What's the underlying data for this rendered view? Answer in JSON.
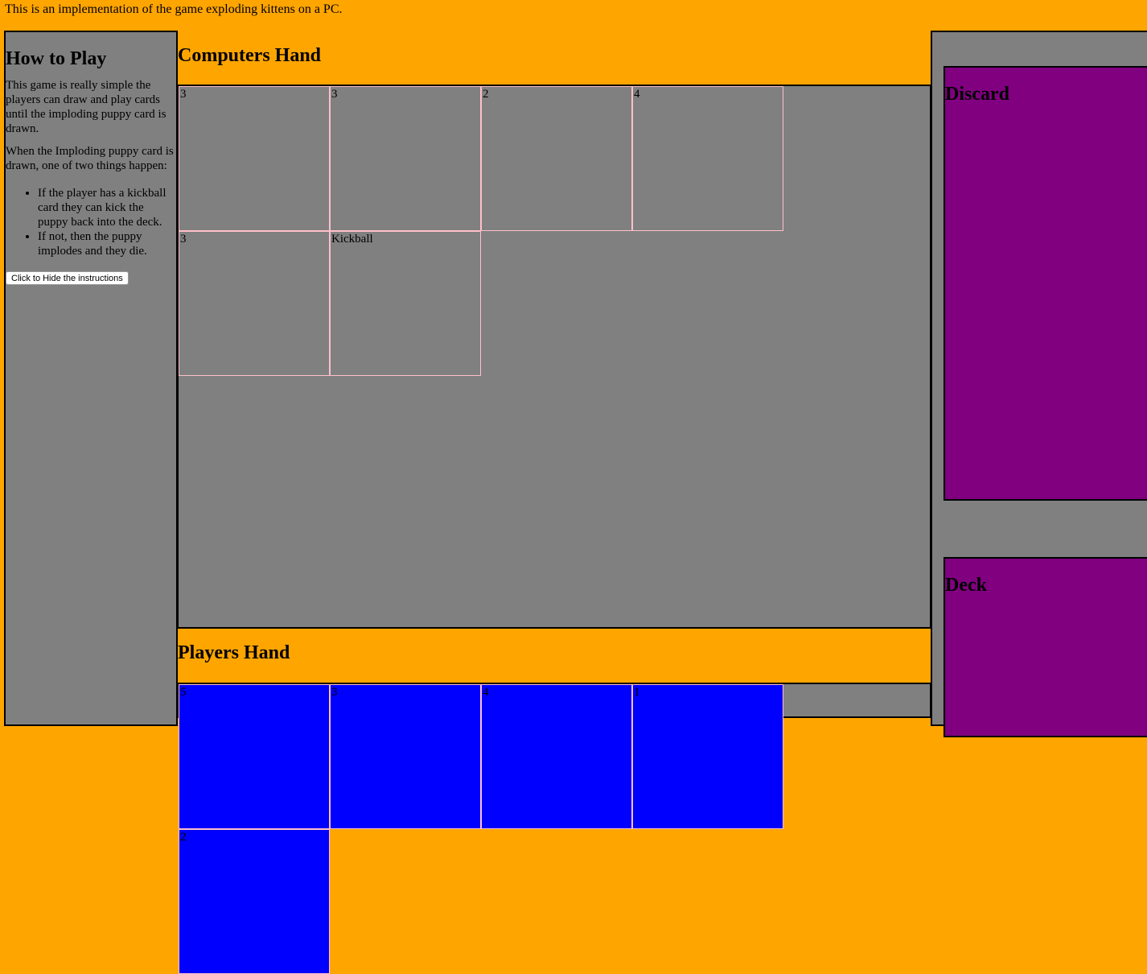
{
  "intro_text": "This is an implementation of the game exploding kittens on a PC.",
  "howto": {
    "title": "How to Play",
    "paragraph1": "This game is really simple the players can draw and play cards until the imploding puppy card is drawn.",
    "paragraph2": "When the Imploding puppy card is drawn, one of two things happen:",
    "rules": [
      "If the player has a kickball card they can kick the puppy back into the deck.",
      "If not, then the puppy implodes and they die."
    ],
    "button_label": "Click to Hide the instructions"
  },
  "computers_hand": {
    "title": "Computers Hand",
    "cards": [
      "3",
      "3",
      "2",
      "4",
      "3",
      "Kickball"
    ]
  },
  "players_hand": {
    "title": "Players Hand",
    "cards": [
      "5",
      "3",
      "4",
      "1",
      "2"
    ]
  },
  "discard": {
    "title": "Discard"
  },
  "deck": {
    "title": "Deck"
  },
  "colors": {
    "page_background": "#FFA500",
    "panel": "#808080",
    "pile": "#800080",
    "player_card": "#0000FF",
    "card_border": "#FFC0CB"
  }
}
